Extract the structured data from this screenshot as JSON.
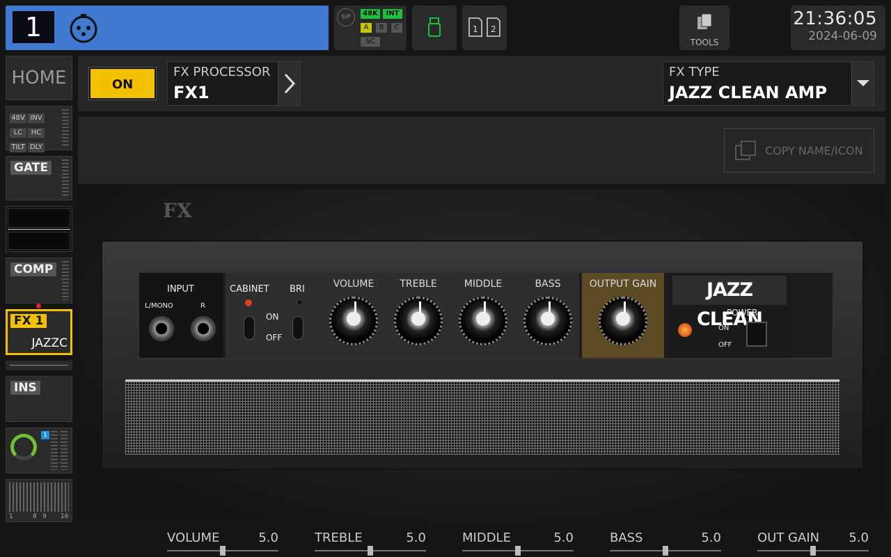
{
  "channel": {
    "number": "1",
    "icon": "xlr-input-icon",
    "color": "#3f7ad0"
  },
  "status": {
    "sip": "SIP",
    "rate": "48K",
    "clock": "INT",
    "slots": [
      "A",
      "B",
      "C"
    ],
    "sc": "SC"
  },
  "tools_label": "TOOLS",
  "clock": {
    "time": "21:36:05",
    "date": "2024-06-09"
  },
  "sidebar": {
    "home": "HOME",
    "mini_buttons": [
      "48V",
      "INV",
      "LC",
      "HC",
      "TILT",
      "DLY"
    ],
    "gate": "GATE",
    "comp": "COMP",
    "fx": {
      "tag": "FX 1",
      "name": "JAZZC"
    },
    "ins": "INS",
    "meter_labels": {
      "one": "1",
      "a": "1",
      "b": "8",
      "c": "9",
      "d": "16"
    }
  },
  "header": {
    "on_label": "ON",
    "fx_processor_label": "FX PROCESSOR",
    "fx_processor_value": "FX1",
    "fx_type_label": "FX TYPE",
    "fx_type_value": "JAZZ CLEAN AMP"
  },
  "copy_label": "COPY NAME/ICON",
  "amp": {
    "logo": "FX",
    "brand": "JAZZ CLEAN",
    "input_label": "INPUT",
    "input_l": "L/MONO",
    "input_r": "R",
    "cabinet": "CABINET",
    "bri": "BRI",
    "on": "ON",
    "off": "OFF",
    "power": "POWER",
    "power_on": "ON",
    "power_off": "OFF",
    "knobs": [
      {
        "label": "VOLUME",
        "value": 5
      },
      {
        "label": "TREBLE",
        "value": 5
      },
      {
        "label": "MIDDLE",
        "value": 5
      },
      {
        "label": "BASS",
        "value": 5
      },
      {
        "label": "OUTPUT GAIN",
        "value": 5
      }
    ],
    "scale_min": "0",
    "scale_mid": "5",
    "scale_max": "10"
  },
  "sliders": [
    {
      "name": "VOLUME",
      "value": "5.0"
    },
    {
      "name": "TREBLE",
      "value": "5.0"
    },
    {
      "name": "MIDDLE",
      "value": "5.0"
    },
    {
      "name": "BASS",
      "value": "5.0"
    },
    {
      "name": "OUT GAIN",
      "value": "5.0"
    }
  ],
  "colors": {
    "accent": "#f2c200",
    "active_green": "#19c23a"
  }
}
